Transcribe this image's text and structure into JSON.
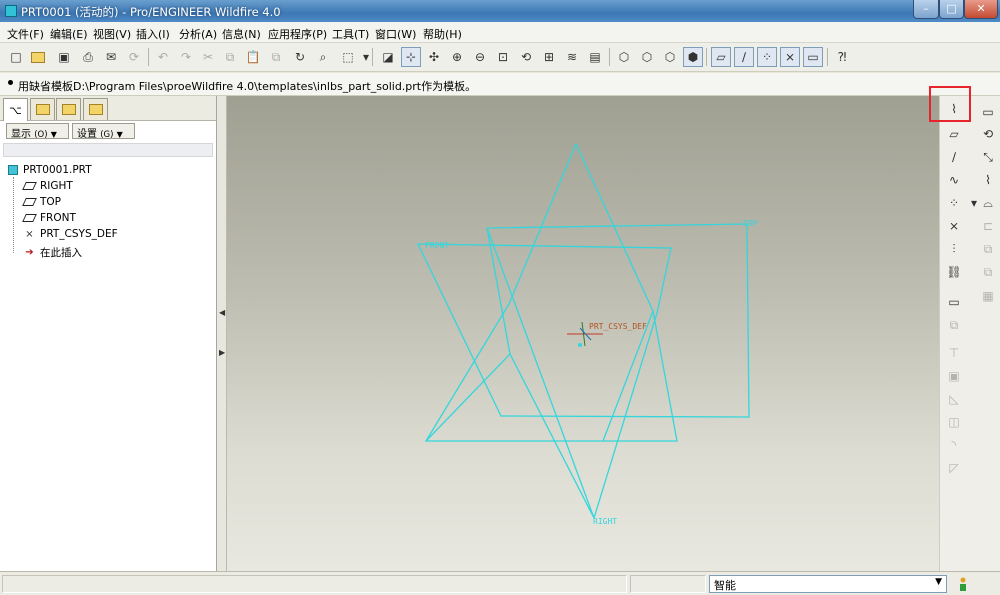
{
  "window": {
    "title": "PRT0001 (活动的) - Pro/ENGINEER Wildfire 4.0",
    "controls": {
      "minimize": "–",
      "maximize": "□",
      "close": "✕"
    }
  },
  "menu": [
    "文件(F)",
    "编辑(E)",
    "视图(V)",
    "插入(I)",
    "分析(A)",
    "信息(N)",
    "应用程序(P)",
    "工具(T)",
    "窗口(W)",
    "帮助(H)"
  ],
  "toolbar": {
    "icons": [
      "new-icon",
      "open-icon",
      "save-icon",
      "print-icon",
      "send-icon",
      "undo-icon",
      "redo-icon",
      "cut-icon",
      "copy-icon",
      "paste-icon",
      "regenerate-icon",
      "find-icon",
      "select-box-icon",
      "repaint-icon",
      "spin-center-icon",
      "orient-icon",
      "zoom-in-icon",
      "zoom-out-icon",
      "refit-icon",
      "reorient-icon",
      "saved-views-icon",
      "layers-icon",
      "view-manager-icon",
      "wireframe-icon",
      "hidden-line-icon",
      "no-hidden-icon",
      "shading-icon",
      "datum-planes-toggle-icon",
      "datum-axes-toggle-icon",
      "datum-points-toggle-icon",
      "csys-toggle-icon",
      "annotations-toggle-icon",
      "context-help-icon"
    ]
  },
  "message": "用缺省模板D:\\Program Files\\proeWildfire 4.0\\templates\\inlbs_part_solid.prt作为模板。",
  "nav_panel": {
    "display_button": "显示",
    "display_hotkey": "(O)",
    "settings_button": "设置",
    "settings_hotkey": "(G)",
    "tree": [
      {
        "label": "PRT0001.PRT",
        "icon": "part-icon"
      },
      {
        "label": "RIGHT",
        "icon": "datum-plane-icon"
      },
      {
        "label": "TOP",
        "icon": "datum-plane-icon"
      },
      {
        "label": "FRONT",
        "icon": "datum-plane-icon"
      },
      {
        "label": "PRT_CSYS_DEF",
        "icon": "csys-icon"
      },
      {
        "label": "在此插入",
        "icon": "insert-here-arrow-icon"
      }
    ]
  },
  "graphics": {
    "background_top": "#9f9f92",
    "background_bottom": "#e8e8e0",
    "datum_color": "#33d6dc",
    "labels": {
      "right": "RIGHT",
      "top": "TOP",
      "front": "FRONT",
      "csys": "PRT_CSYS_DEF"
    }
  },
  "right_toolbar": {
    "highlighted": "sketch-tool-icon",
    "highlight_color": "#e8232c"
  },
  "statusbar": {
    "filter_value": "智能"
  }
}
